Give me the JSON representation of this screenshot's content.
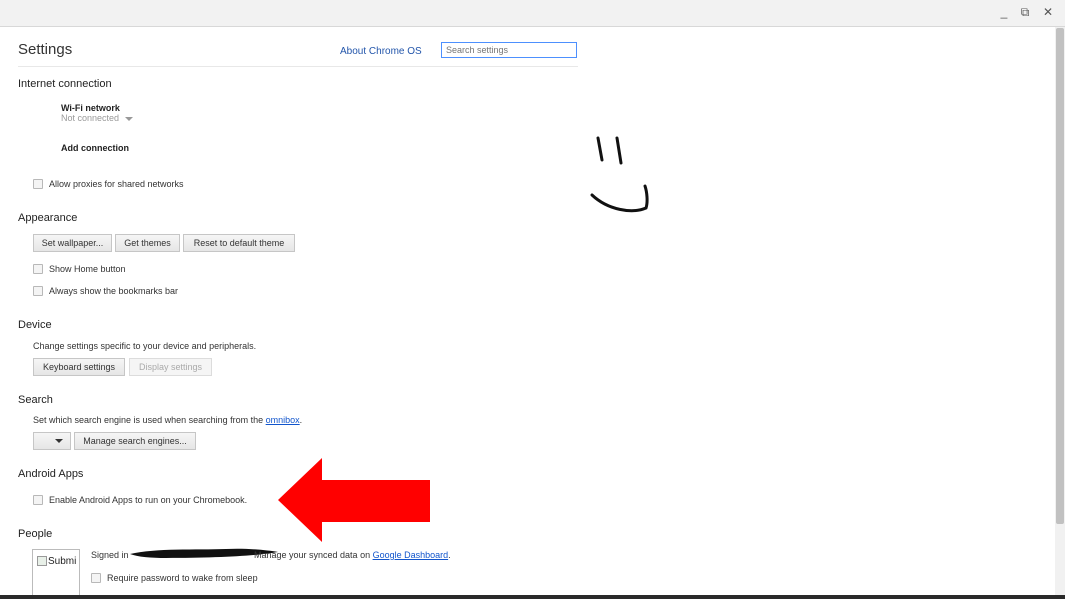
{
  "window": {
    "minimize": "_",
    "restore": "⧉",
    "close": "✕"
  },
  "header": {
    "title": "Settings",
    "about_link": "About Chrome OS",
    "search_placeholder": "Search settings"
  },
  "internet": {
    "title": "Internet connection",
    "wifi_label": "Wi-Fi network",
    "wifi_status": "Not connected",
    "add_connection": "Add connection",
    "allow_proxies": "Allow proxies for shared networks"
  },
  "appearance": {
    "title": "Appearance",
    "set_wallpaper": "Set wallpaper...",
    "get_themes": "Get themes",
    "reset_theme": "Reset to default theme",
    "show_home": "Show Home button",
    "show_bookmarks": "Always show the bookmarks bar"
  },
  "device": {
    "title": "Device",
    "description": "Change settings specific to your device and peripherals.",
    "keyboard_settings": "Keyboard settings",
    "display_settings": "Display settings"
  },
  "search": {
    "title": "Search",
    "description_prefix": "Set which search engine is used when searching from the ",
    "omnibox_link": "omnibox",
    "description_suffix": ".",
    "manage_engines": "Manage search engines..."
  },
  "android": {
    "title": "Android Apps",
    "enable_label": "Enable Android Apps to run on your Chromebook."
  },
  "people": {
    "title": "People",
    "avatar_alt": "Submi",
    "signed_in_prefix": "Signed in",
    "manage_text": "Manage your synced data on ",
    "dashboard_link": "Google Dashboard",
    "period": ".",
    "require_password": "Require password to wake from sleep"
  },
  "colors": {
    "arrow": "#ff0000",
    "link": "#1155cc",
    "focus": "#4d90fe"
  }
}
